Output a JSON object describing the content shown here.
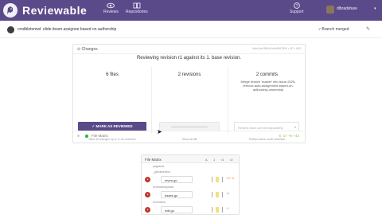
{
  "header": {
    "app_title": "Reviewable",
    "nav": [
      {
        "label": "Reviews",
        "icon": "eye-icon"
      },
      {
        "label": "Repositories",
        "icon": "repositories-icon"
      },
      {
        "label": "Support",
        "icon": "help-icon"
      }
    ],
    "user": {
      "name": "dlbradshaw"
    },
    "colors": {
      "bar": "#5b4a8a"
    }
  },
  "pr": {
    "title": "cmdbletomwl: elide iteam assignee based on authorship",
    "status": "Branch merged"
  },
  "changes": {
    "heading": "Changes",
    "meta": "3a4e1ac2f8b9c0d4e5f67890 • 4f7 • 683",
    "summary": "Reviewing revision r1 against its 1. base revision.",
    "files": {
      "count_label": "6 files",
      "button_label": "MARK AS REVIEWED",
      "note": "Mark all changes up to r1 as reviewed"
    },
    "revisions": {
      "count_label": "2 revisions",
      "note": "Show all diff"
    },
    "commits": {
      "count_label": "2 commits",
      "text": "Merge branch 'master' into issue-2025-remove-auto-assignment-based-on-authorship-ownership",
      "select_placeholder": "Review each commit separately",
      "note": "Partial review mode selection"
    },
    "file_matrix_row": {
      "label": "File Matrix",
      "counts": "6  -17  +6  +43"
    }
  },
  "matrix": {
    "title": "File Matrix",
    "columns": [
      "Δ",
      "1",
      "r1",
      "r2"
    ],
    "folders": [
      "pagesnet",
      "_githubreview",
      "reviewableparser",
      "reviewtest"
    ],
    "files": [
      {
        "name": "reven.go",
        "delta": "+17 -6"
      },
      {
        "name": "bases.go",
        "delta": "+6"
      },
      {
        "name": "edit.go",
        "delta": "+1"
      }
    ]
  }
}
